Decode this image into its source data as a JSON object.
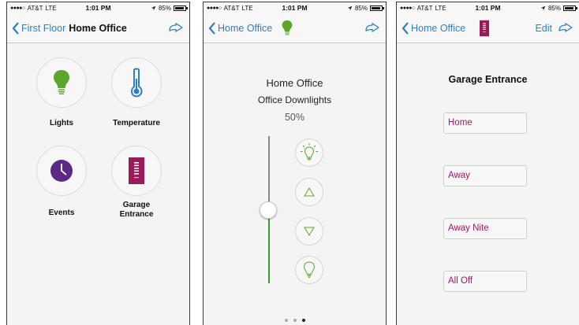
{
  "status_bar": {
    "signal": "●●●●○",
    "carrier": "AT&T",
    "network": "LTE",
    "time": "1:01 PM",
    "battery": "85%"
  },
  "colors": {
    "accent": "#2f80c3",
    "green": "#5aa52a",
    "purple": "#5b2a86",
    "magenta": "#9b1a5a"
  },
  "panel1": {
    "back_label": "First Floor",
    "title": "Home Office",
    "tiles": [
      {
        "label": "Lights",
        "icon": "lightbulb-icon"
      },
      {
        "label": "Temperature",
        "icon": "thermometer-icon"
      },
      {
        "label": "Events",
        "icon": "clock-icon"
      },
      {
        "label": "Garage Entrance",
        "label_line1": "Garage",
        "label_line2": "Entrance",
        "icon": "keypad-icon"
      }
    ]
  },
  "panel2": {
    "back_label": "Home Office",
    "room": "Home Office",
    "device": "Office Downlights",
    "level_text": "50%",
    "level_fraction": 0.5,
    "buttons": [
      "light-on-icon",
      "raise-icon",
      "lower-icon",
      "light-off-icon"
    ],
    "page_index": 3,
    "page_count": 3
  },
  "panel3": {
    "back_label": "Home Office",
    "edit_label": "Edit",
    "title": "Garage Entrance",
    "scenes": [
      "Home",
      "Away",
      "Away Nite",
      "All Off"
    ]
  }
}
